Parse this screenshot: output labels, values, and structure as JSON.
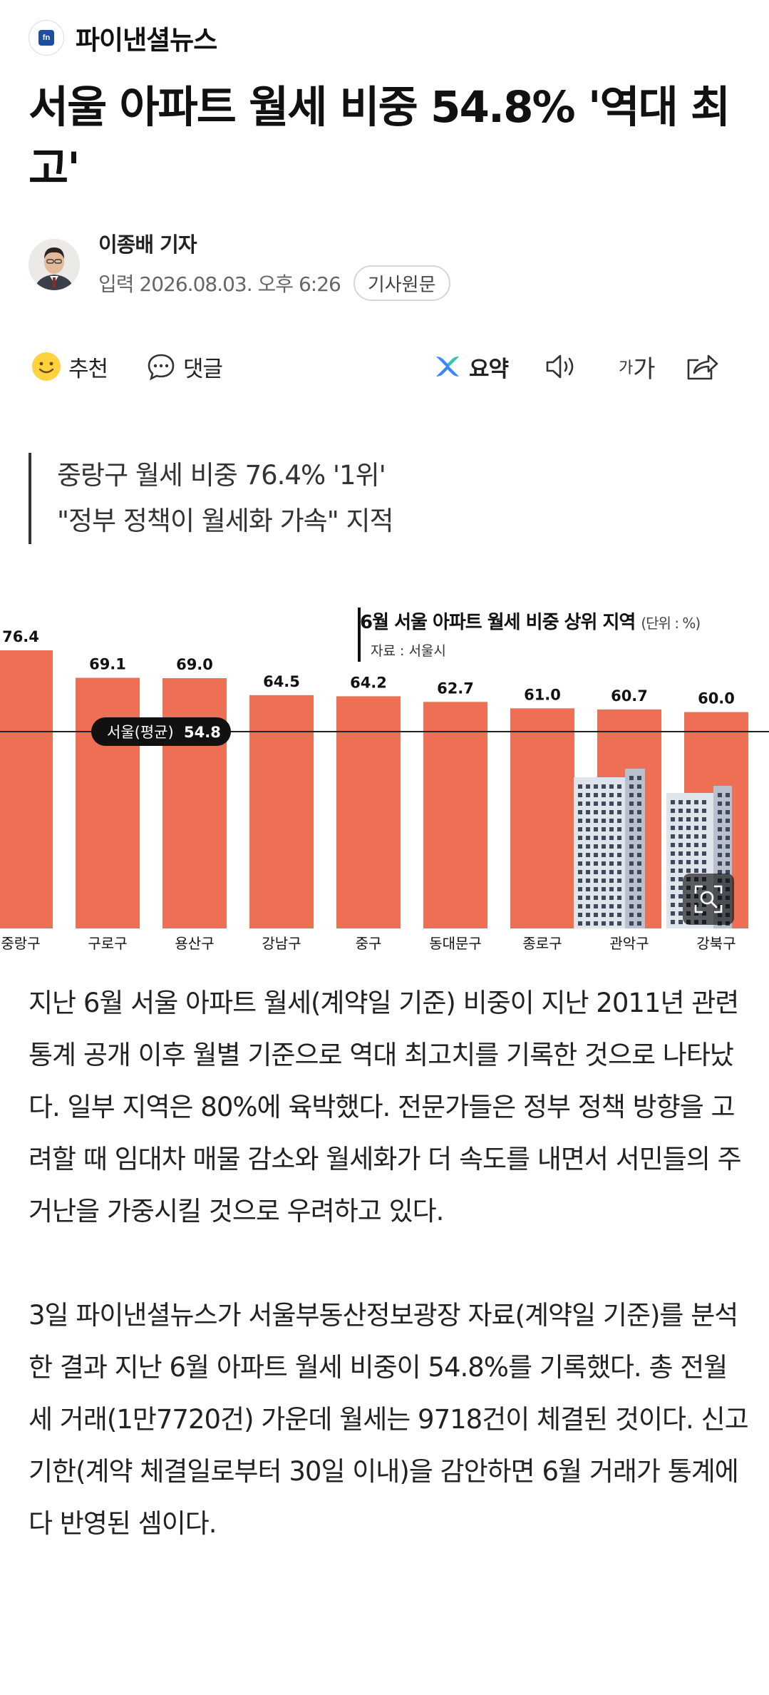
{
  "publisher": {
    "logo_text": "fn",
    "name": "파이낸셜뉴스"
  },
  "headline": "서울 아파트 월세 비중 54.8% '역대 최고'",
  "byline": {
    "reporter": "이종배 기자",
    "date": "입력 2026.08.03. 오후 6:26",
    "original_button": "기사원문"
  },
  "toolbar": {
    "recommend": "추천",
    "comment": "댓글",
    "summary": "요약",
    "font_size_small": "가",
    "font_size_large": "가"
  },
  "subheadlines": [
    "중랑구 월세 비중 76.4% '1위'",
    "\"정부 정책이 월세화 가속\" 지적"
  ],
  "chart_data": {
    "type": "bar",
    "title": "6월 서울 아파트 월세 비중 상위 지역",
    "unit": "(단위 : %)",
    "source": "자료 : 서울시",
    "categories": [
      "중랑구",
      "구로구",
      "용산구",
      "강남구",
      "중구",
      "동대문구",
      "종로구",
      "관악구",
      "강북구"
    ],
    "values": [
      76.4,
      69.1,
      69.0,
      64.5,
      64.2,
      62.7,
      61.0,
      60.7,
      60.0
    ],
    "value_labels": [
      "76.4",
      "69.1",
      "69.0",
      "64.5",
      "64.2",
      "62.7",
      "61.0",
      "60.7",
      "60.0"
    ],
    "reference_line": {
      "label": "서울(평균)",
      "value": 54.8,
      "value_label": "54.8"
    },
    "bar_color": "#ee7054",
    "ylim": [
      0,
      80
    ]
  },
  "body": [
    "지난 6월 서울 아파트 월세(계약일 기준) 비중이 지난 2011년 관련 통계 공개 이후 월별 기준으로 역대 최고치를 기록한 것으로 나타났다. 일부 지역은 80%에 육박했다. 전문가들은 정부 정책 방향을 고려할 때 임대차 매물 감소와 월세화가 더 속도를 내면서 서민들의 주거난을 가중시킬 것으로 우려하고 있다.",
    "3일 파이낸셜뉴스가 서울부동산정보광장 자료(계약일 기준)를 분석한 결과 지난 6월 아파트 월세 비중이 54.8%를 기록했다. 총 전월세 거래(1만7720건) 가운데 월세는 9718건이 체결된 것이다. 신고기한(계약 체결일로부터 30일 이내)을 감안하면 6월 거래가 통계에 다 반영된 셈이다."
  ],
  "colors": {
    "accent_bar": "#ee7054",
    "summary_icon": "#3a86ff"
  }
}
